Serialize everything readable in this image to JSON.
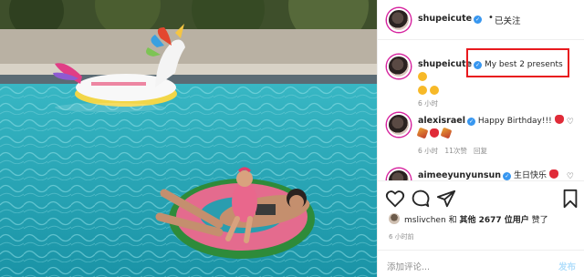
{
  "post": {
    "author": "shupeicute",
    "follow_dot": "•",
    "follow_label": "已关注"
  },
  "comments": [
    {
      "user": "shupeicute",
      "text": "My best 2 presents",
      "time": "6 小时",
      "likes": "",
      "reply": ""
    },
    {
      "user": "alexisrael",
      "text": "Happy Birthday!!!",
      "time": "6 小时",
      "likes": "11次赞",
      "reply": "回复"
    },
    {
      "user": "aimeeyunyunsun",
      "text": "生日快乐",
      "time": "",
      "likes": "",
      "reply": ""
    }
  ],
  "likes_line": {
    "liker": "mslivchen",
    "and_label": "和",
    "others": "其他 2677 位用户",
    "suffix": "赞了"
  },
  "timestamp": "6 小时前",
  "add_comment": {
    "placeholder": "添加评论...",
    "post_label": "发布"
  },
  "icons": [
    "heart-icon",
    "comment-icon",
    "share-icon",
    "bookmark-icon",
    "verified-badge-icon"
  ],
  "colors": {
    "highlight_box": "#e8191e",
    "verified": "#3897f0",
    "pool_water": "#1e9fb0"
  }
}
